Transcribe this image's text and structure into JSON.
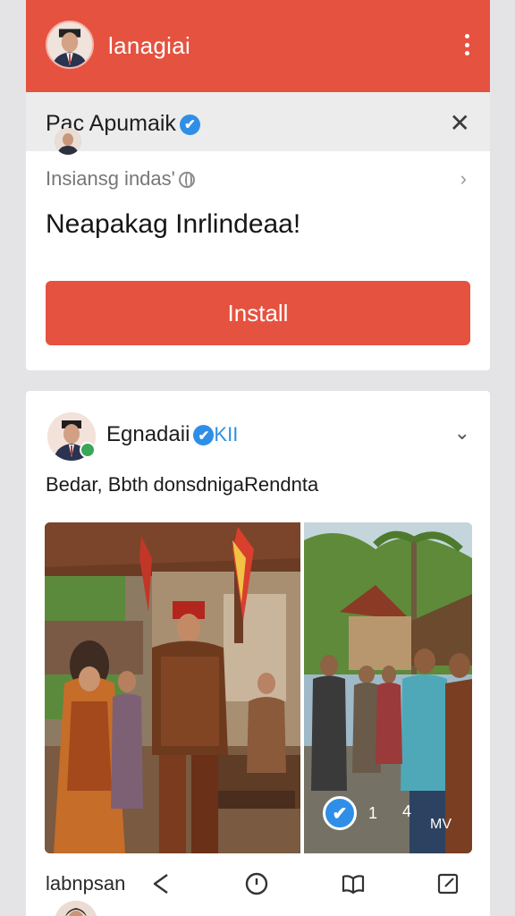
{
  "header": {
    "title": "lanagiai",
    "avatar_icon": "avatar-icon",
    "menu_icon": "more-vertical-icon",
    "brand_color": "#e5523f"
  },
  "promo": {
    "name": "Pac Apumaik",
    "verified_mark": "✔",
    "close_label": "✕",
    "subtitle": "Insiansg indas'",
    "headline": "Neapakag Inrlindeaa!",
    "install_label": "Install",
    "chevron": "›"
  },
  "post": {
    "author": "Egnadaii",
    "verified_mark": "✔",
    "badge_text": "KII",
    "menu_chevron": "⌄",
    "text": "Bedar, Bbth donsdnigaRendnta",
    "photo_overlay": {
      "check": "✔",
      "count_a": "1",
      "count_b": "4",
      "count_c": "MV"
    },
    "action_label": "labnpsan",
    "action_icons": [
      "share-icon",
      "clock-icon",
      "book-icon",
      "edit-icon"
    ]
  },
  "colors": {
    "accent": "#e5523f",
    "verified": "#2f8fe6",
    "background": "#e4e4e6"
  }
}
